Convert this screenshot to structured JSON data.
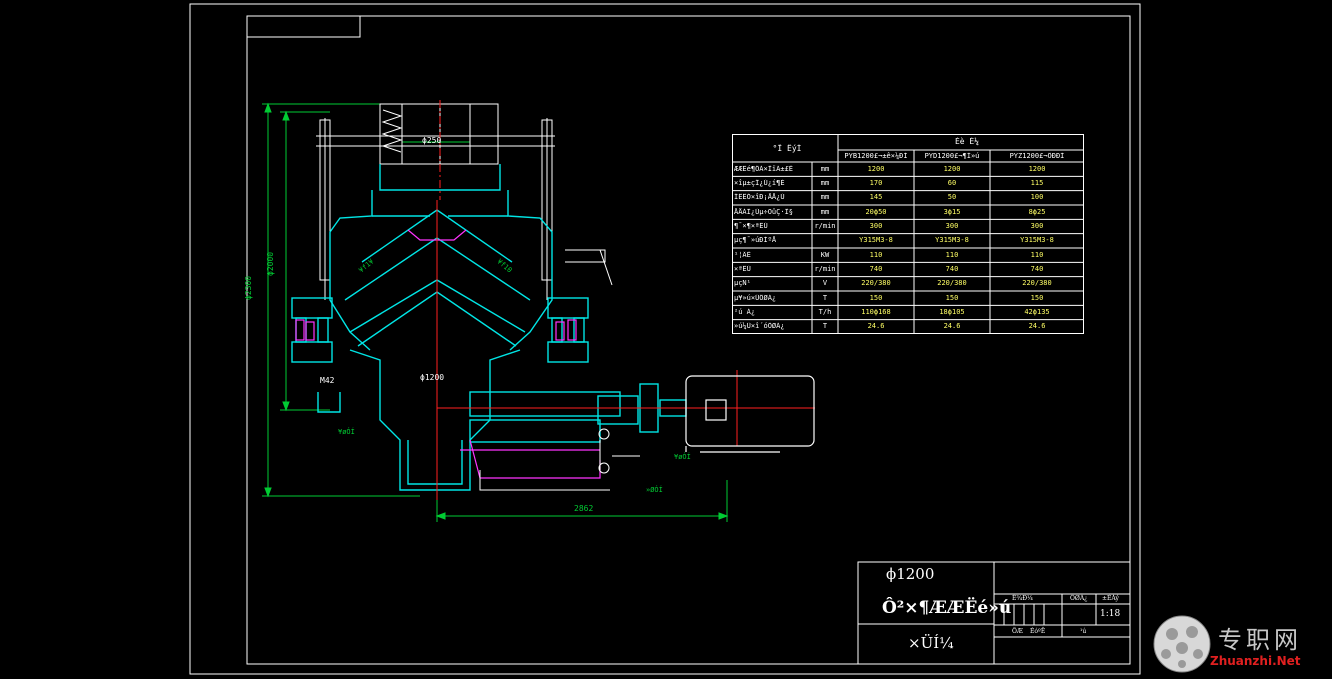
{
  "drawing": {
    "dim_width_top": "ϕ250",
    "dim_height_left_outer": "ϕ2300",
    "dim_height_left_inner": "ϕ2000",
    "dim_base_width": "2862",
    "dim_inner_diameter": "ϕ1200",
    "label_m42": "M42",
    "label_oil_left": "¥øÓÍ",
    "label_oil_in": "¥øÓÍ",
    "label_oil_out": "»ØÓÍ",
    "label_pin_left": "¥f1¥",
    "label_pin_right": "¥f10"
  },
  "spec_table": {
    "header_param": "°Î        ÊýÍ",
    "header_group": "Éè        É¼",
    "columns": [
      "PYB1200£¬±ê×¼ÐÍ",
      "PYD1200£¬¶Ì»ú",
      "PYZ1200£¬ÖÐÐÍ"
    ],
    "rows": [
      {
        "label": "ÆÆËé¶ÔÁ×ÎïÁ±£Ê",
        "unit": "mm",
        "values": [
          "1200",
          "1200",
          "1200"
        ]
      },
      {
        "label": "×îµ±çÎ¿Ú¿í¶È",
        "unit": "mm",
        "values": [
          "170",
          "60",
          "115"
        ]
      },
      {
        "label": "ÎÊÊÓ×îÐ¡ÅÅ¿Ú",
        "unit": "mm",
        "values": [
          "145",
          "50",
          "100"
        ]
      },
      {
        "label": "ÅÅÁÏ¿Úµ÷ÕûÇ·Î§",
        "unit": "mm",
        "values": [
          "20ϕ50",
          "3ϕ15",
          "8ϕ25"
        ]
      },
      {
        "label": "¶¯×¶×ªËÙ",
        "unit": "r/min",
        "values": [
          "300",
          "300",
          "300"
        ]
      },
      {
        "label": "µç¶¯»úÐÍºÅ",
        "unit": "",
        "values": [
          "Y315M3-8",
          "Y315M3-8",
          "Y315M3-8"
        ]
      },
      {
        "label": "¹¦ÂÊ",
        "unit": "KW",
        "values": [
          "110",
          "110",
          "110"
        ]
      },
      {
        "label": "×ªËÙ",
        "unit": "r/min",
        "values": [
          "740",
          "740",
          "740"
        ]
      },
      {
        "label": "µçÑ¹",
        "unit": "V",
        "values": [
          "220/380",
          "220/380",
          "220/380"
        ]
      },
      {
        "label": "µ¥»ú×ÜÖØÁ¿",
        "unit": "T",
        "values": [
          "150",
          "150",
          "150"
        ]
      },
      {
        "label": "²ú Á¿",
        "unit": "T/h",
        "values": [
          "110ϕ168",
          "18ϕ105",
          "42ϕ135"
        ]
      },
      {
        "label": "»ú¼Ü×î´óÖØÁ¿",
        "unit": "T",
        "values": [
          "24.6",
          "24.6",
          "24.6"
        ]
      }
    ]
  },
  "title_block": {
    "size_label": "ϕ1200",
    "name": "Ô²×¶ÆÆËé»ú",
    "subtitle": "×ÜÍ¼",
    "grid_header": [
      "Ê¾Ð¼",
      "ÖØÁ¿",
      "±ÈÀý"
    ],
    "scale": "1:18",
    "row_labels": [
      "ÖÆ",
      "ÉóºË",
      "¹ú"
    ]
  },
  "watermark": {
    "cn": "专职网",
    "en": "Zhuanzhi.Net"
  },
  "colors": {
    "background": "#000000",
    "frame": "#ffffff",
    "body_cyan": "#00e5e5",
    "dims_green": "#00cc33",
    "axis_red": "#ff2020",
    "accent_magenta": "#ff33ff",
    "table_yellow": "#ffff66"
  }
}
